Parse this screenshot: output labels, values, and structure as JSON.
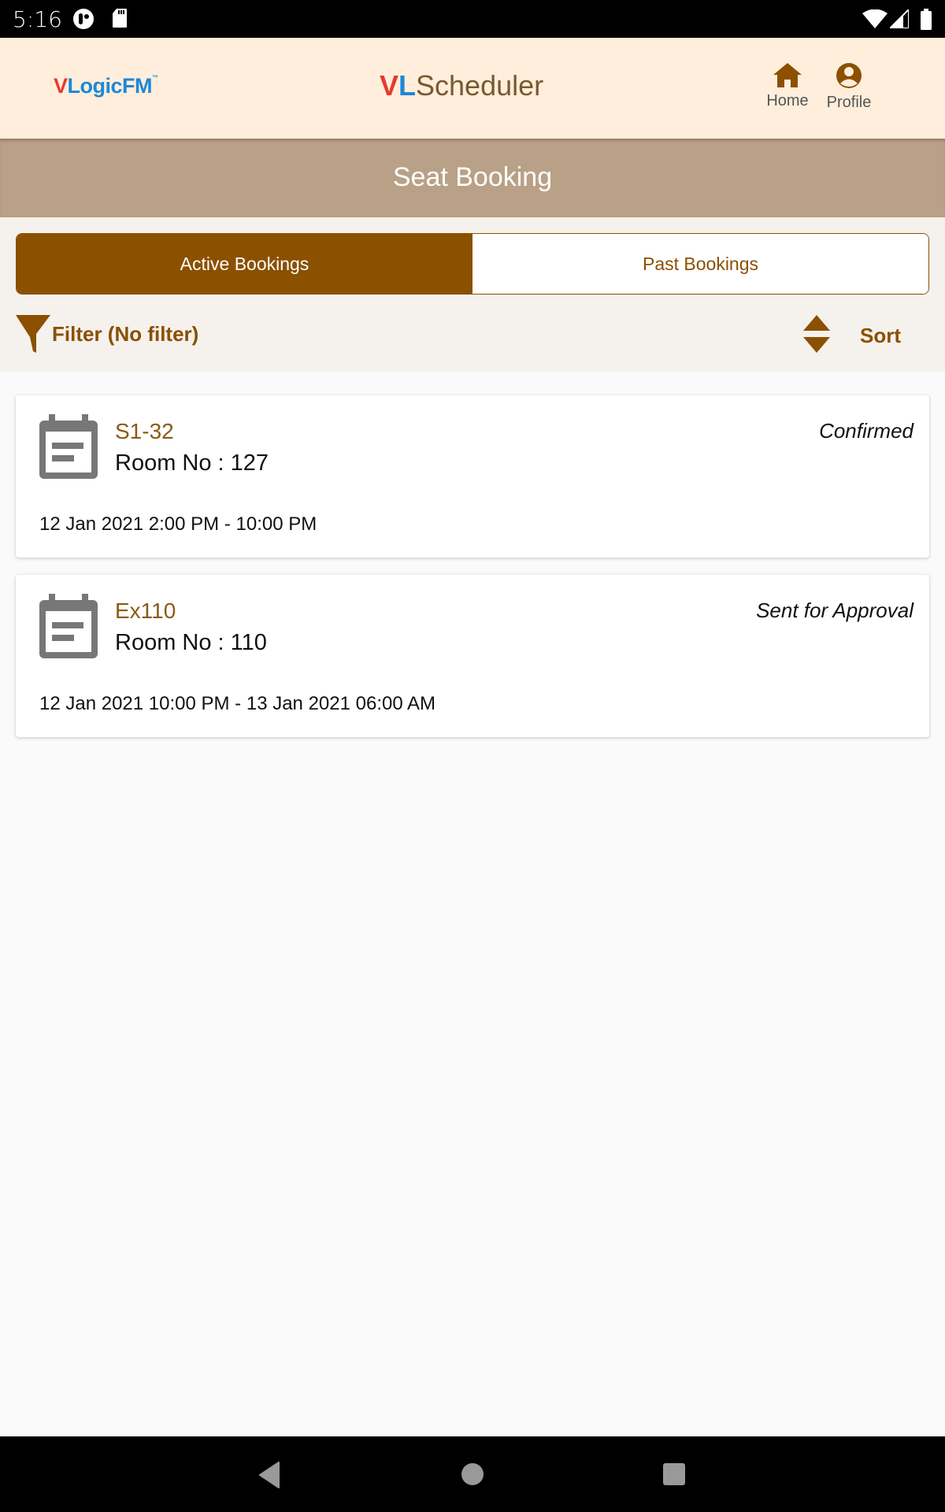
{
  "status_bar": {
    "time": "5:16",
    "left_icons": [
      "pie-notification-icon",
      "sd-card-icon"
    ],
    "right_icons": [
      "wifi-icon",
      "cellular-signal-icon",
      "battery-icon"
    ]
  },
  "header": {
    "brand_left": {
      "v": "V",
      "rest": "LogicFM",
      "tm": "™"
    },
    "brand_center": {
      "v": "V",
      "l": "L",
      "rest": "Scheduler"
    },
    "nav": [
      {
        "label": "Home",
        "icon": "home-icon"
      },
      {
        "label": "Profile",
        "icon": "profile-icon"
      }
    ]
  },
  "page": {
    "title": "Seat Booking"
  },
  "tabs": [
    {
      "label": "Active Bookings",
      "active": true
    },
    {
      "label": "Past Bookings",
      "active": false
    }
  ],
  "filter": {
    "label": "Filter (No filter)",
    "icon": "funnel-icon"
  },
  "sort": {
    "label": "Sort",
    "icon": "sort-updown-icon"
  },
  "bookings": [
    {
      "seat": "S1-32",
      "room": "Room No : 127",
      "status": "Confirmed",
      "time": "12 Jan 2021 2:00 PM - 10:00 PM"
    },
    {
      "seat": "Ex110",
      "room": "Room No : 110",
      "status": "Sent for Approval",
      "time": "12 Jan 2021 10:00 PM - 13 Jan 2021 06:00 AM"
    }
  ],
  "colors": {
    "brand_brown": "#8b5000",
    "header_bg": "#ffeedb",
    "title_bar_bg": "#b8a186",
    "filter_bg": "#f5f1ed"
  },
  "system_nav": [
    "back-icon",
    "home-circle-icon",
    "recents-icon"
  ]
}
